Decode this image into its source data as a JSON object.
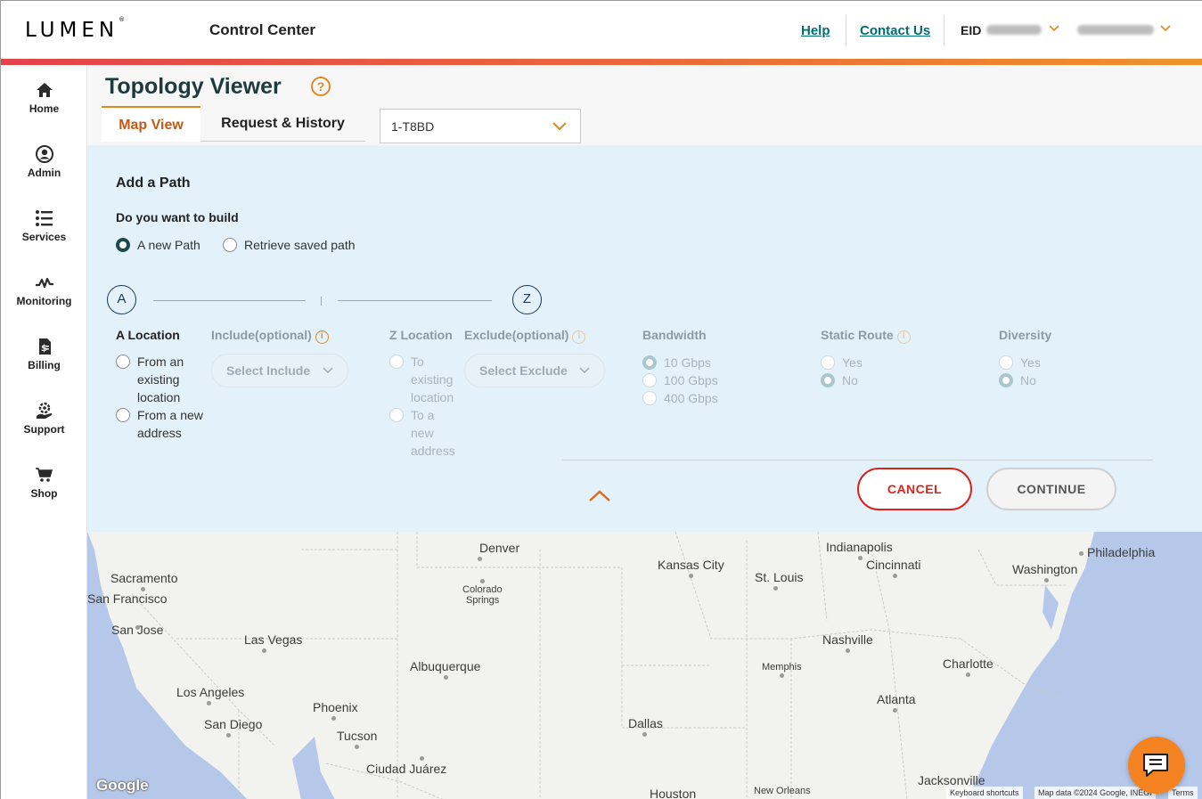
{
  "header": {
    "logo": "LUMEN",
    "logo_mark": "®",
    "app_title": "Control Center",
    "help_label": "Help",
    "contact_label": "Contact Us",
    "eid_label": "EID"
  },
  "sidebar": {
    "items": [
      {
        "label": "Home",
        "icon": "home-icon"
      },
      {
        "label": "Admin",
        "icon": "user-icon"
      },
      {
        "label": "Services",
        "icon": "list-icon"
      },
      {
        "label": "Monitoring",
        "icon": "pulse-icon"
      },
      {
        "label": "Billing",
        "icon": "invoice-icon"
      },
      {
        "label": "Support",
        "icon": "support-icon"
      },
      {
        "label": "Shop",
        "icon": "cart-icon"
      }
    ]
  },
  "page": {
    "title": "Topology Viewer",
    "help_glyph": "?",
    "tabs": [
      {
        "label": "Map View",
        "active": true
      },
      {
        "label": "Request & History",
        "active": false
      }
    ],
    "service_select": {
      "value": "1-T8BD"
    }
  },
  "panel": {
    "title": "Add a Path",
    "question": "Do you want to build",
    "build_options": [
      {
        "label": "A new Path",
        "checked": true
      },
      {
        "label": "Retrieve saved path",
        "checked": false
      }
    ],
    "point_a": "A",
    "point_z": "Z",
    "a_location": {
      "label": "A Location",
      "options": [
        {
          "lines": [
            "From an",
            "existing",
            "location"
          ],
          "checked": false
        },
        {
          "lines": [
            "From a new",
            "address"
          ],
          "checked": false
        }
      ]
    },
    "include": {
      "label": "Include(optional)",
      "placeholder": "Select Include"
    },
    "z_location": {
      "label": "Z Location",
      "options": [
        {
          "lines": [
            "To",
            "existing",
            "location"
          ],
          "checked": false
        },
        {
          "lines": [
            "To a",
            "new",
            "address"
          ],
          "checked": false
        }
      ]
    },
    "exclude": {
      "label": "Exclude(optional)",
      "placeholder": "Select Exclude"
    },
    "bandwidth": {
      "label": "Bandwidth",
      "options": [
        {
          "label": "10 Gbps",
          "checked": true
        },
        {
          "label": "100 Gbps",
          "checked": false
        },
        {
          "label": "400 Gbps",
          "checked": false
        }
      ]
    },
    "static_route": {
      "label": "Static Route",
      "options": [
        {
          "label": "Yes",
          "checked": false
        },
        {
          "label": "No",
          "checked": true
        }
      ]
    },
    "diversity": {
      "label": "Diversity",
      "options": [
        {
          "label": "Yes",
          "checked": false
        },
        {
          "label": "No",
          "checked": true
        }
      ]
    },
    "cancel_label": "CANCEL",
    "continue_label": "CONTINUE"
  },
  "map": {
    "cities": [
      {
        "name": "Denver"
      },
      {
        "name": "Colorado"
      },
      {
        "name": "Springs"
      },
      {
        "name": "Kansas City"
      },
      {
        "name": "St. Louis"
      },
      {
        "name": "Indianapolis"
      },
      {
        "name": "Cincinnati"
      },
      {
        "name": "Washington"
      },
      {
        "name": "Philadelphia"
      },
      {
        "name": "Sacramento"
      },
      {
        "name": "San Francisco"
      },
      {
        "name": "San Jose"
      },
      {
        "name": "Las Vegas"
      },
      {
        "name": "Albuquerque"
      },
      {
        "name": "Nashville"
      },
      {
        "name": "Memphis"
      },
      {
        "name": "Charlotte"
      },
      {
        "name": "Los Angeles"
      },
      {
        "name": "Phoenix"
      },
      {
        "name": "San Diego"
      },
      {
        "name": "Tucson"
      },
      {
        "name": "Atlanta"
      },
      {
        "name": "Dallas"
      },
      {
        "name": "Ciudad Juárez"
      },
      {
        "name": "Jacksonville"
      },
      {
        "name": "Houston"
      },
      {
        "name": "New Orleans"
      }
    ],
    "google_label": "Google",
    "keyboard_shortcuts": "Keyboard shortcuts",
    "map_data": "Map data ©2024 Google, INEGI",
    "terms": "Terms"
  },
  "colors": {
    "brand_orange": "#e08a1e",
    "title_teal": "#1d3b3d",
    "link_teal": "#006d6f",
    "cancel_red": "#d8241f",
    "panel_bg": "#e3f1fb"
  }
}
